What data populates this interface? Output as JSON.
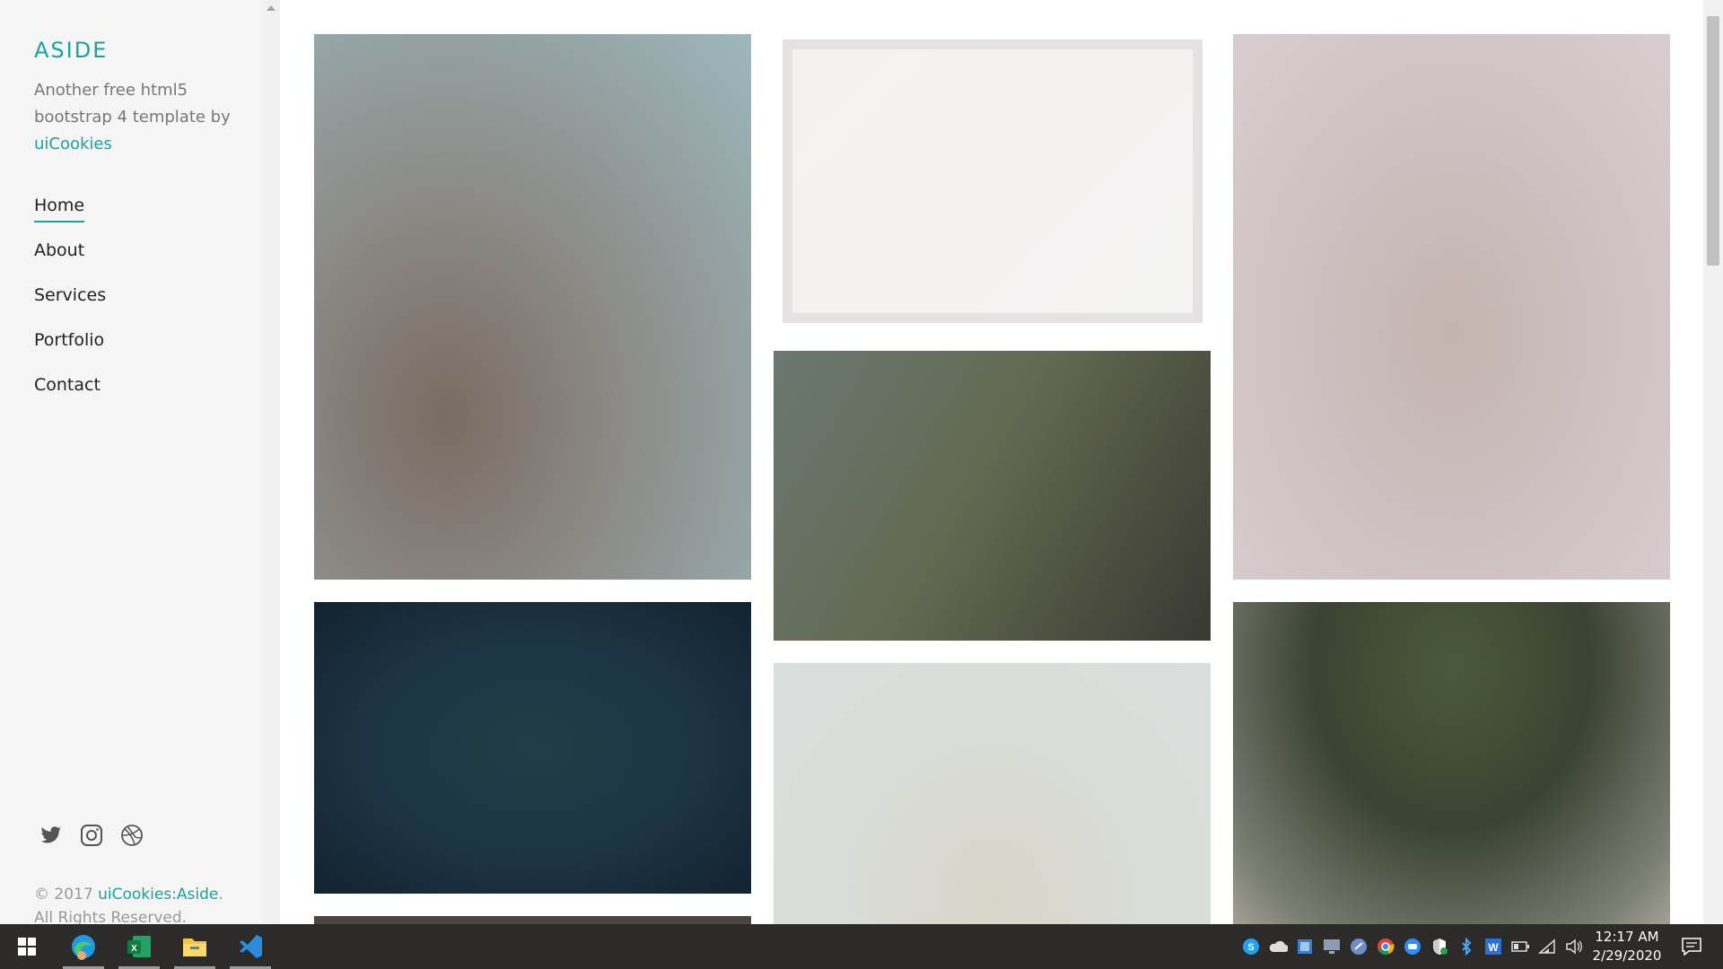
{
  "sidebar": {
    "brand": "ASIDE",
    "tagline_pre": "Another free html5 bootstrap 4 template by ",
    "tagline_link": "uiCookies",
    "nav": [
      {
        "label": "Home",
        "active": true
      },
      {
        "label": "About",
        "active": false
      },
      {
        "label": "Services",
        "active": false
      },
      {
        "label": "Portfolio",
        "active": false
      },
      {
        "label": "Contact",
        "active": false
      }
    ],
    "social": [
      "twitter-icon",
      "instagram-icon",
      "dribbble-icon"
    ],
    "footer_pre": "© 2017 ",
    "footer_link": "uiCookies:Aside",
    "footer_post": ".",
    "footer_line2": "All Rights Reserved."
  },
  "colors": {
    "accent": "#17a2a2",
    "sidebar_bg": "#f5f5f5",
    "taskbar_bg": "#2c2b2a"
  },
  "taskbar": {
    "apps": [
      "windows-start-icon",
      "edge-icon",
      "excel-icon",
      "file-explorer-icon",
      "vscode-icon"
    ],
    "tray": [
      "skype-icon",
      "onedrive-icon",
      "tray-app-icon",
      "monitor-icon",
      "tray-app2-icon",
      "chrome-icon",
      "tray-app3-icon",
      "shield-icon",
      "bluetooth-icon",
      "tray-app4-icon",
      "battery-icon",
      "wifi-icon",
      "volume-icon"
    ],
    "time": "12:17 AM",
    "date": "2/29/2020"
  }
}
